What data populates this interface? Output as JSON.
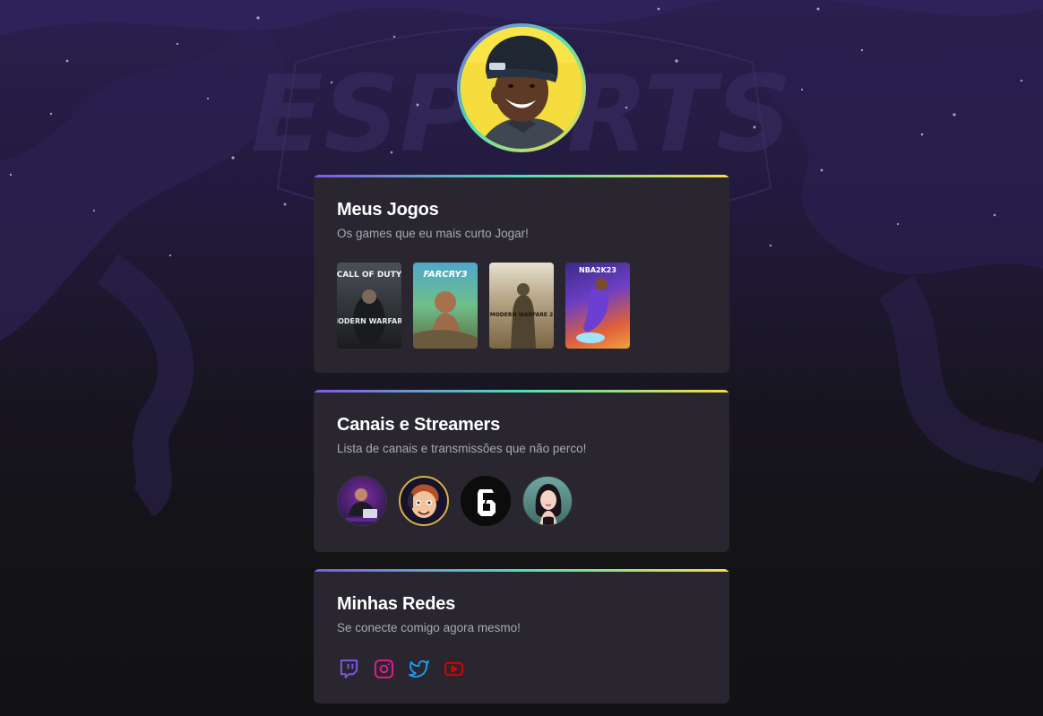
{
  "profile": {
    "avatar_icon": "profile-photo"
  },
  "background": {
    "watermark": "ESPORTS"
  },
  "games_card": {
    "title": "Meus Jogos",
    "subtitle": "Os games que eu mais curto Jogar!",
    "games": [
      {
        "name": "Call of Duty Modern Warfare",
        "cover_top": "CALL OF DUTY",
        "cover_bottom": "MODERN WARFARE"
      },
      {
        "name": "Far Cry 3",
        "cover_top": "FARCRY3"
      },
      {
        "name": "Call of Duty Modern Warfare 2",
        "cover_top": "MODERN WARFARE 2"
      },
      {
        "name": "NBA 2K23",
        "cover_top": "NBA2K23"
      }
    ]
  },
  "channels_card": {
    "title": "Canais e Streamers",
    "subtitle": "Lista de canais e transmissões que não perco!",
    "channels": [
      {
        "icon": "streamer-desk-avatar"
      },
      {
        "icon": "cartoon-streamer-avatar"
      },
      {
        "icon": "rainbow-six-logo"
      },
      {
        "icon": "female-streamer-avatar"
      }
    ]
  },
  "socials_card": {
    "title": "Minhas Redes",
    "subtitle": "Se conecte comigo agora mesmo!",
    "links": [
      {
        "icon": "twitch-icon",
        "color": "#8257e5"
      },
      {
        "icon": "instagram-icon",
        "color": "#e11d8f"
      },
      {
        "icon": "twitter-icon",
        "color": "#1d9bf0"
      },
      {
        "icon": "youtube-icon",
        "color": "#e00000"
      }
    ]
  }
}
